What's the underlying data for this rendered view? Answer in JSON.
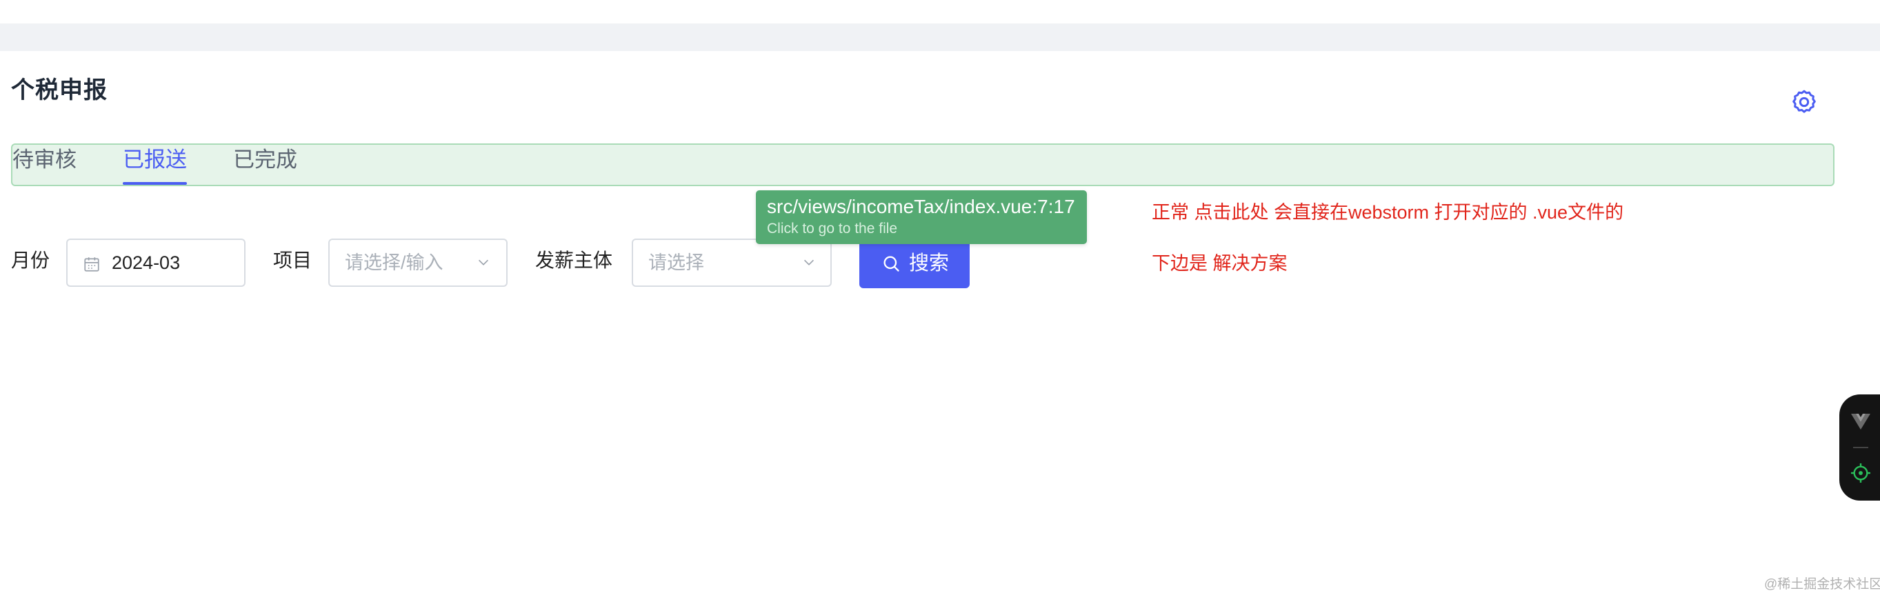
{
  "page": {
    "title": "个税申报"
  },
  "tabs": [
    {
      "label": "待审核",
      "active": false
    },
    {
      "label": "已报送",
      "active": true
    },
    {
      "label": "已完成",
      "active": false
    }
  ],
  "filters": {
    "month_label": "月份",
    "month_value": "2024-03",
    "project_label": "项目",
    "project_placeholder": "请选择/输入",
    "payer_label": "发薪主体",
    "payer_placeholder": "请选择",
    "search_label": "搜索"
  },
  "tooltip": {
    "path": "src/views/incomeTax/index.vue:7:17",
    "hint": "Click to go to the file"
  },
  "annotations": {
    "line1": "正常 点击此处 会直接在webstorm 打开对应的 .vue文件的",
    "line2": "下边是 解决方案"
  },
  "watermark": "@稀土掘金技术社区",
  "icons": {
    "settings": "gear-icon",
    "calendar": "calendar-icon",
    "chevron": "chevron-down-icon",
    "search": "search-icon",
    "vue": "vue-logo-icon",
    "inspector": "crosshair-icon"
  },
  "colors": {
    "accent": "#4b5df2",
    "tab_bar_bg": "#e6f4ea",
    "tooltip_bg": "#55aa73",
    "annotation": "#e1251b",
    "devtools_bg": "#141414"
  }
}
